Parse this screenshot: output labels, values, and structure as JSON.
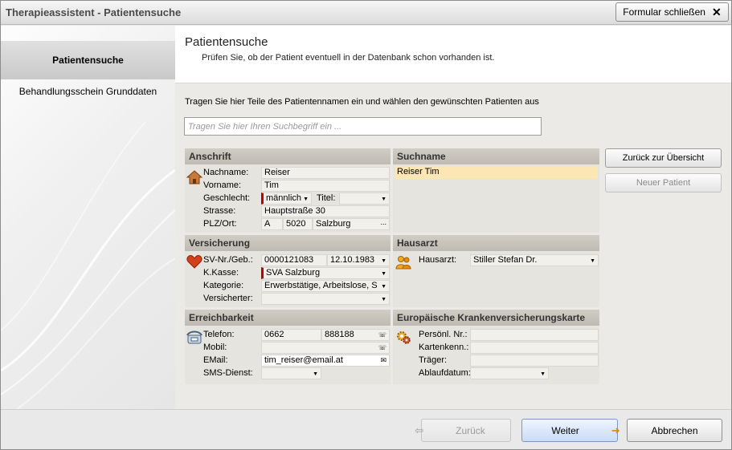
{
  "window": {
    "title": "Therapieassistent - Patientensuche",
    "close_form_label": "Formular schließen"
  },
  "sidebar": {
    "items": [
      {
        "label": "Patientensuche",
        "active": true
      },
      {
        "label": "Behandlungsschein Grunddaten",
        "active": false
      }
    ]
  },
  "header": {
    "title": "Patientensuche",
    "subtitle": "Prüfen Sie, ob der Patient eventuell in der Datenbank schon vorhanden ist."
  },
  "instruction": "Tragen Sie hier Teile des Patientennamen ein und wählen den gewünschten Patienten aus",
  "search": {
    "placeholder": "Tragen Sie hier Ihren Suchbegriff ein ...",
    "value": ""
  },
  "anschrift": {
    "heading": "Anschrift",
    "nachname_label": "Nachname:",
    "nachname": "Reiser",
    "vorname_label": "Vorname:",
    "vorname": "Tim",
    "geschlecht_label": "Geschlecht:",
    "geschlecht": "männlich",
    "titel_label": "Titel:",
    "titel": "",
    "strasse_label": "Strasse:",
    "strasse": "Hauptstraße 30",
    "plzort_label": "PLZ/Ort:",
    "land": "A",
    "plz": "5020",
    "ort": "Salzburg",
    "ort_btn": "..."
  },
  "suchname": {
    "heading": "Suchname",
    "value": "Reiser Tim"
  },
  "versicherung": {
    "heading": "Versicherung",
    "svnr_label": "SV-Nr./Geb.:",
    "svnr": "0000121083",
    "geb": "12.10.1983",
    "kkasse_label": "K.Kasse:",
    "kkasse": "SVA Salzburg",
    "kategorie_label": "Kategorie:",
    "kategorie": "Erwerbstätige, Arbeitslose, S",
    "versicherter_label": "Versicherter:",
    "versicherter": ""
  },
  "hausarzt": {
    "heading": "Hausarzt",
    "label": "Hausarzt:",
    "value": "Stiller Stefan Dr."
  },
  "erreichbarkeit": {
    "heading": "Erreichbarkeit",
    "telefon_label": "Telefon:",
    "telefon_vorwahl": "0662",
    "telefon_nr": "888188",
    "mobil_label": "Mobil:",
    "mobil": "",
    "email_label": "EMail:",
    "email": "tim_reiser@email.at",
    "sms_label": "SMS-Dienst:",
    "sms": ""
  },
  "ekvk": {
    "heading": "Europäische Krankenversicherungskarte",
    "nr_label": "Persönl. Nr.:",
    "nr": "",
    "kennung_label": "Kartenkenn.:",
    "kennung": "",
    "traeger_label": "Träger:",
    "traeger": "",
    "ablauf_label": "Ablaufdatum:",
    "ablauf": ""
  },
  "side_buttons": {
    "zurueck_uebersicht": "Zurück zur Übersicht",
    "neuer_patient": "Neuer Patient"
  },
  "footer": {
    "back": "Zurück",
    "next": "Weiter",
    "cancel": "Abbrechen"
  },
  "colors": {
    "accent": "#c9dcf7",
    "required_marker": "#c00000",
    "selection": "#fbe6b4"
  }
}
